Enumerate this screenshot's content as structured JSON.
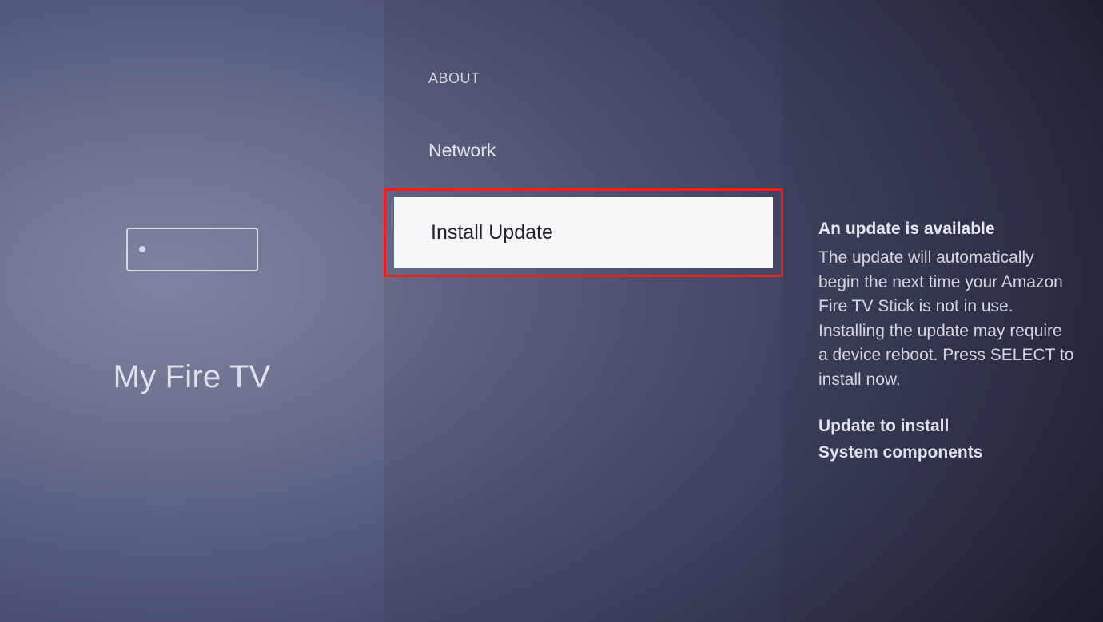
{
  "left": {
    "title": "My Fire TV"
  },
  "middle": {
    "section_label": "ABOUT",
    "items": [
      {
        "label": "Network"
      },
      {
        "label": "Install Update",
        "selected": true
      }
    ]
  },
  "right": {
    "heading": "An update is available",
    "body": "The update will automatically begin the next time your Amazon Fire TV Stick is not in use. Installing the update may require a device reboot. Press SELECT to install now.",
    "sub1": "Update to install",
    "sub2": "System components"
  }
}
